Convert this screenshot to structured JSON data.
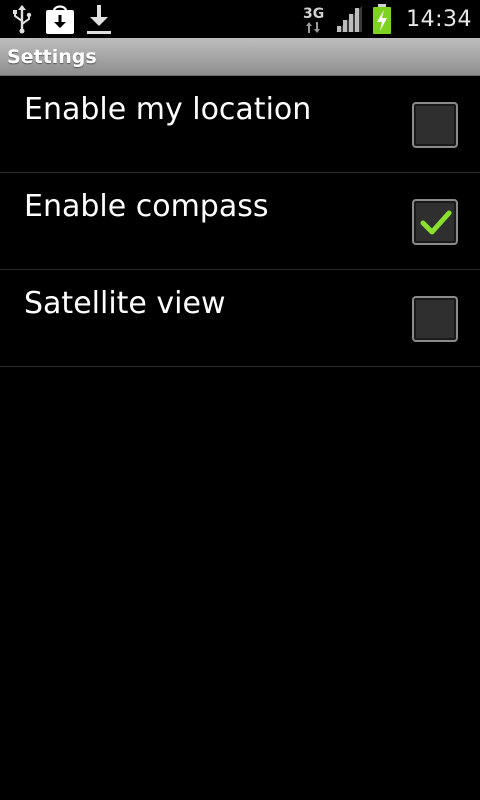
{
  "status_bar": {
    "icons_left": [
      "usb-icon",
      "store-download-icon",
      "download-icon"
    ],
    "network": "3G",
    "time": "14:34",
    "battery_color": "#7ed321",
    "check_color": "#8be02d"
  },
  "title_bar": {
    "title": "Settings"
  },
  "preferences": [
    {
      "label": "Enable my location",
      "checked": false
    },
    {
      "label": "Enable compass",
      "checked": true
    },
    {
      "label": "Satellite view",
      "checked": false
    }
  ]
}
